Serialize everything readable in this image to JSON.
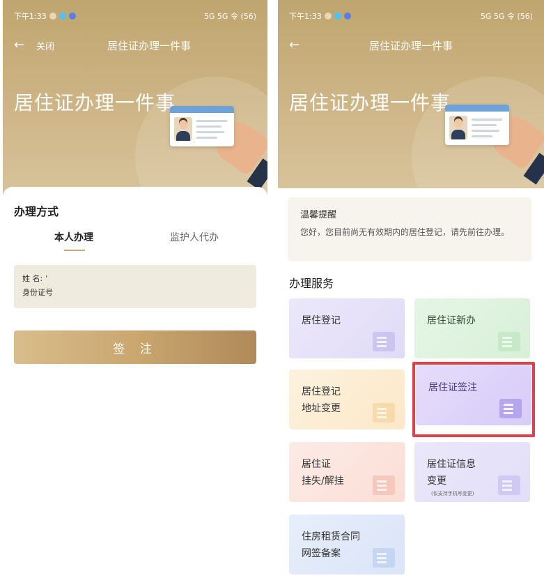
{
  "status_bar": {
    "time": "下午1:33",
    "right": "5G 5G 令 (56)"
  },
  "left_screen": {
    "nav": {
      "back_icon": "arrow-left-icon",
      "close_label": "关闭",
      "title": "居住证办理一件事"
    },
    "hero_title": "居住证办理一件事",
    "panel_title": "办理方式",
    "tabs": [
      {
        "label": "本人办理",
        "active": true
      },
      {
        "label": "监护人代办",
        "active": false
      }
    ],
    "form": {
      "name_label": "姓 名:",
      "name_value": "'",
      "id_label": "身份证号",
      "id_value": ""
    },
    "submit_button": "签 注"
  },
  "right_screen": {
    "nav": {
      "back_icon": "arrow-left-icon",
      "title": "居住证办理一件事"
    },
    "hero_title": "居住证办理一件事",
    "notice": {
      "title": "温馨提醒",
      "text": "您好，您目前尚无有效期内的居住登记，请先前往办理。"
    },
    "services_title": "办理服务",
    "services": [
      {
        "line1": "居住登记",
        "line2": "",
        "note": ""
      },
      {
        "line1": "居住证新办",
        "line2": "",
        "note": ""
      },
      {
        "line1": "居住登记",
        "line2": "地址变更",
        "note": ""
      },
      {
        "line1": "居住证签注",
        "line2": "",
        "note": ""
      },
      {
        "line1": "居住证",
        "line2": "挂失/解挂",
        "note": ""
      },
      {
        "line1": "居住证信息",
        "line2": "变更",
        "note": "(仅支持手机号变更)"
      },
      {
        "line1": "住房租赁合同",
        "line2": "网签备案",
        "note": ""
      }
    ],
    "highlighted_service": "居住证签注"
  },
  "colors": {
    "hero_gold": "#c8ac78",
    "button_gold": "#c9a76f",
    "highlight_red": "#e0404a"
  }
}
